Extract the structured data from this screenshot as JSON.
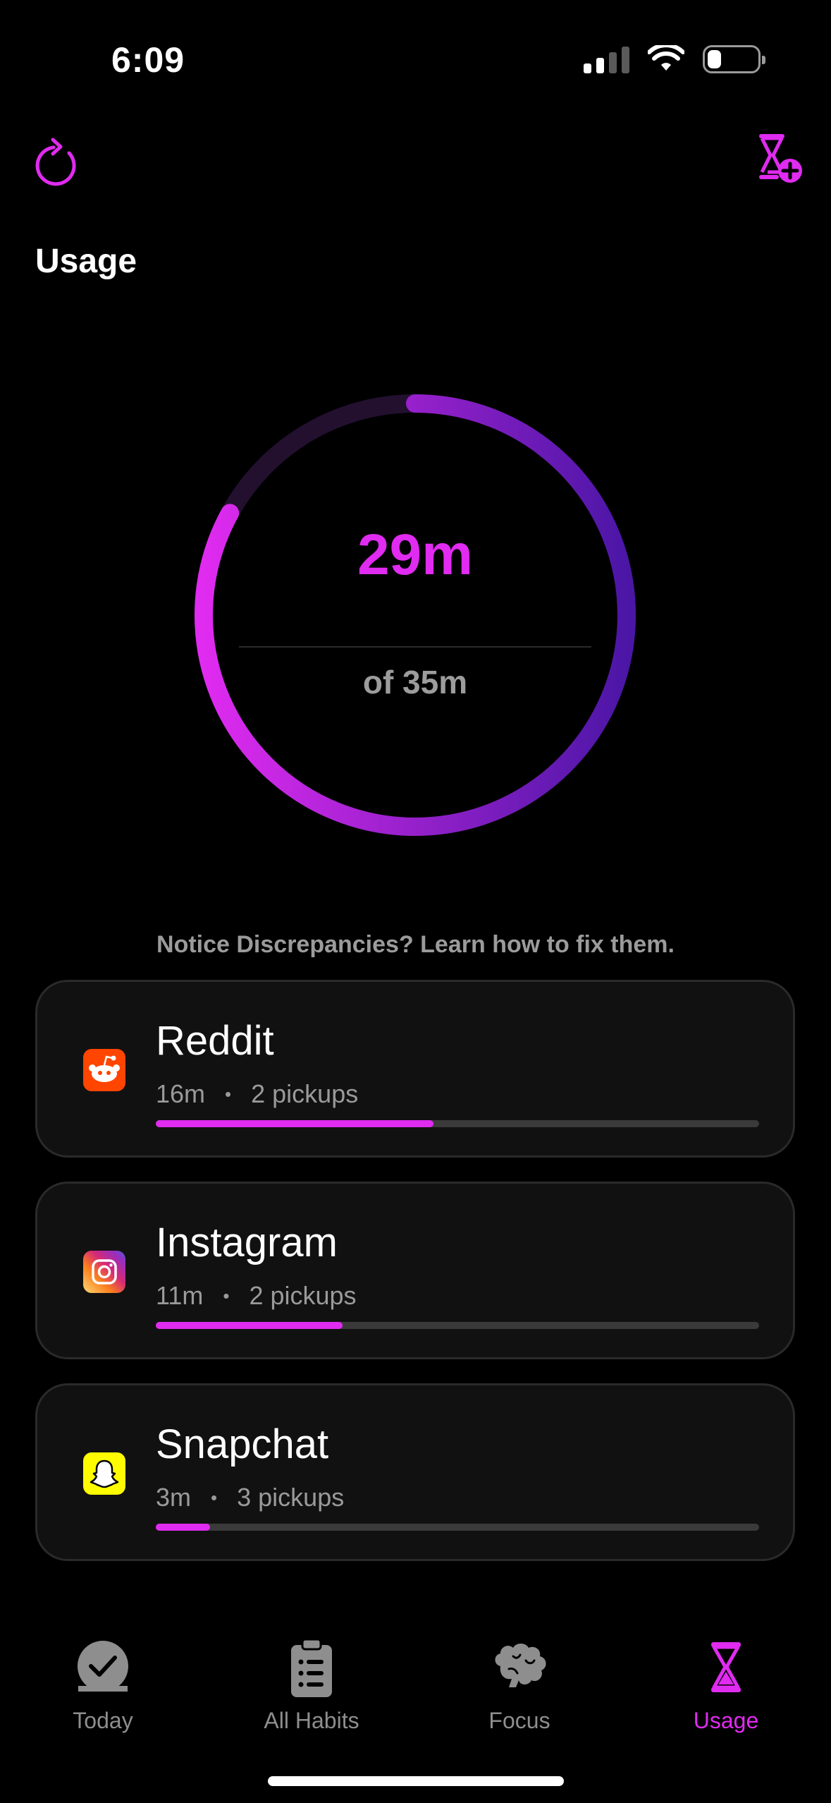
{
  "status_bar": {
    "time": "6:09",
    "icons": [
      "signal-icon",
      "wifi-icon",
      "battery-icon"
    ]
  },
  "header": {
    "title": "Usage",
    "left_icon": "refresh-icon",
    "right_icon": "timer-add-icon"
  },
  "summary": {
    "used": "29m",
    "limit": "of 35m",
    "progress": 0.83
  },
  "notice": "Notice Discrepancies? Learn how to fix them.",
  "apps": [
    {
      "name": "Reddit",
      "time": "16m",
      "pickups": "2 pickups",
      "icon": "reddit-icon",
      "progress": 0.46
    },
    {
      "name": "Instagram",
      "time": "11m",
      "pickups": "2 pickups",
      "icon": "instagram-icon",
      "progress": 0.31
    },
    {
      "name": "Snapchat",
      "time": "3m",
      "pickups": "3 pickups",
      "icon": "snapchat-icon",
      "progress": 0.09
    }
  ],
  "tabs": [
    {
      "label": "Today",
      "icon": "check-circle-icon",
      "active": false
    },
    {
      "label": "All Habits",
      "icon": "clipboard-list-icon",
      "active": false
    },
    {
      "label": "Focus",
      "icon": "brain-icon",
      "active": false
    },
    {
      "label": "Usage",
      "icon": "hourglass-icon",
      "active": true
    }
  ],
  "colors": {
    "accent": "#e02bf0",
    "ring_start": "#e02bf0",
    "ring_end": "#4b16a6",
    "card_bg": "#111111"
  }
}
